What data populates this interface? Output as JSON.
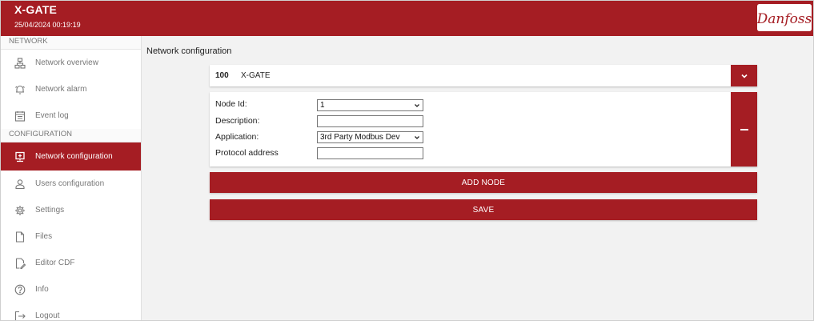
{
  "header": {
    "title": "X-GATE",
    "datetime": "25/04/2024 00:19:19",
    "logo_text": "Danfoss",
    "brand_color": "#a51d23"
  },
  "sidebar": {
    "network_label": "NETWORK",
    "configuration_label": "CONFIGURATION",
    "items": [
      {
        "label": "Network overview",
        "icon": "network-tree-icon"
      },
      {
        "label": "Network alarm",
        "icon": "alarm-icon"
      },
      {
        "label": "Event log",
        "icon": "event-log-icon"
      },
      {
        "label": "Network configuration",
        "icon": "network-config-icon",
        "active": true
      },
      {
        "label": "Users configuration",
        "icon": "user-icon"
      },
      {
        "label": "Settings",
        "icon": "gear-icon"
      },
      {
        "label": "Files",
        "icon": "file-icon"
      },
      {
        "label": "Editor CDF",
        "icon": "edit-file-icon"
      },
      {
        "label": "Info",
        "icon": "help-icon"
      },
      {
        "label": "Logout",
        "icon": "logout-icon"
      }
    ]
  },
  "main": {
    "page_title": "Network configuration",
    "node_header": {
      "number": "100",
      "name": "X-GATE"
    },
    "form": {
      "node_id_label": "Node Id:",
      "node_id_value": "1",
      "description_label": "Description:",
      "description_value": "",
      "application_label": "Application:",
      "application_value": "3rd Party Modbus Dev",
      "protocol_label": "Protocol address",
      "protocol_value": ""
    },
    "add_node_label": "ADD NODE",
    "save_label": "SAVE"
  }
}
